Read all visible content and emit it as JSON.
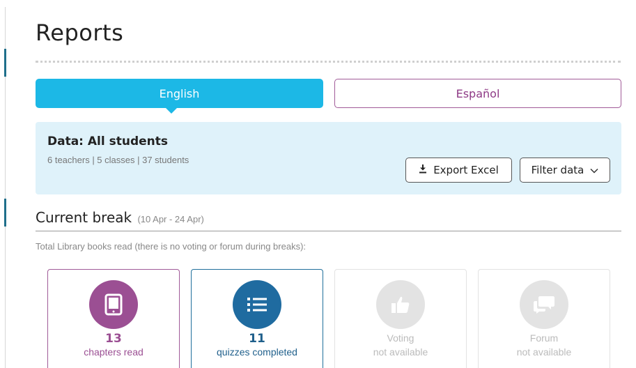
{
  "page": {
    "title": "Reports"
  },
  "language_tabs": [
    {
      "label": "English",
      "active": true
    },
    {
      "label": "Español",
      "active": false
    }
  ],
  "data_panel": {
    "title": "Data: All students",
    "summary": "6 teachers | 5 classes | 37 students",
    "export_label": "Export Excel",
    "export_icon": "download-icon",
    "filter_label": "Filter data",
    "filter_icon": "chevron-down-icon"
  },
  "section": {
    "heading": "Current break",
    "range": "(10 Apr - 24 Apr)",
    "description": "Total Library books read (there is no voting or forum during breaks):"
  },
  "stats": [
    {
      "icon": "tablet-icon",
      "value": "13",
      "label": "chapters read",
      "color": "#9b4f93"
    },
    {
      "icon": "list-icon",
      "value": "11",
      "label": "quizzes completed",
      "color": "#1f6ba0"
    },
    {
      "icon": "thumbs-up-icon",
      "title": "Voting",
      "label": "not available",
      "color": "#e3e3e3"
    },
    {
      "icon": "chat-bubbles-icon",
      "title": "Forum",
      "label": "not available",
      "color": "#e3e3e3"
    }
  ],
  "colors": {
    "accent_blue": "#1cb8e6",
    "purple": "#9b4f93",
    "panel_bg": "#dff2fa"
  }
}
